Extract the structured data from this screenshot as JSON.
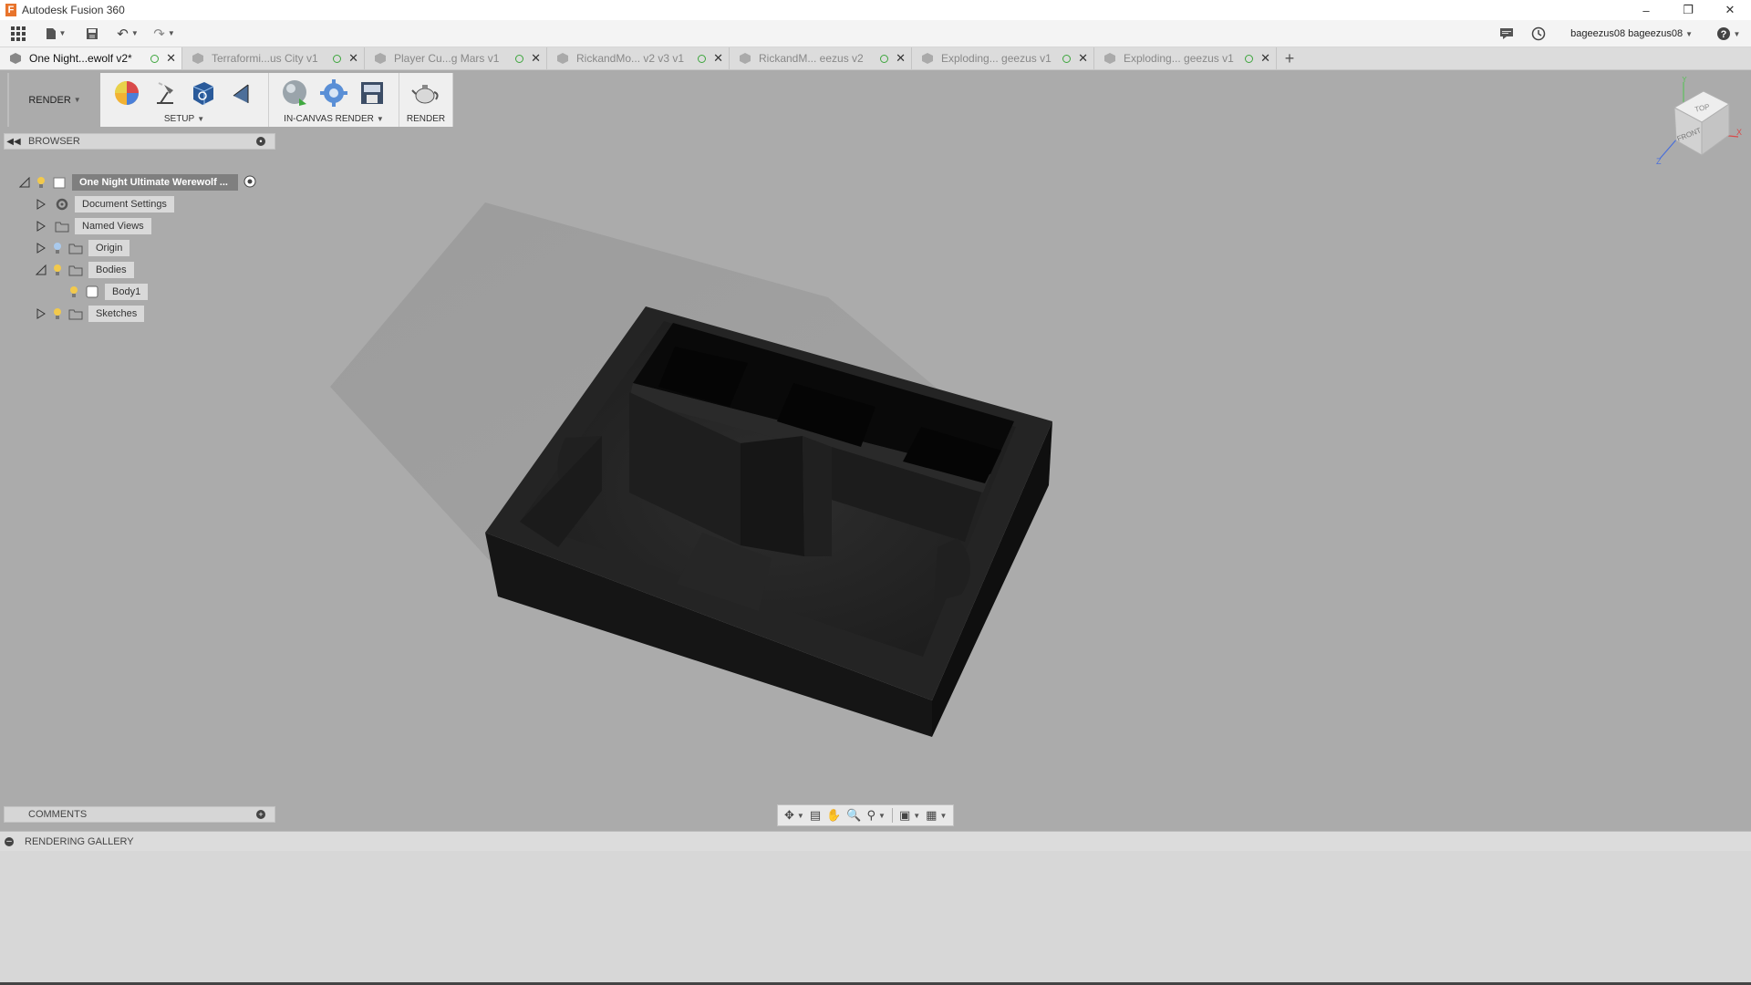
{
  "window": {
    "title": "Autodesk Fusion 360"
  },
  "appbar": {
    "user": "bageezus08 bageezus08"
  },
  "tabs": [
    {
      "label": "One Night...ewolf v2*",
      "active": true
    },
    {
      "label": "Terraformi...us City v1",
      "active": false
    },
    {
      "label": "Player Cu...g Mars v1",
      "active": false
    },
    {
      "label": "RickandMo... v2 v3 v1",
      "active": false
    },
    {
      "label": "RickandM... eezus v2",
      "active": false
    },
    {
      "label": "Exploding... geezus v1",
      "active": false
    },
    {
      "label": "Exploding... geezus v1",
      "active": false
    }
  ],
  "toolbar": {
    "workspace": "RENDER",
    "groups": [
      {
        "label": "SETUP"
      },
      {
        "label": "IN-CANVAS RENDER"
      },
      {
        "label": "RENDER"
      }
    ]
  },
  "browser": {
    "title": "BROWSER",
    "root": "One Night Ultimate Werewolf ...",
    "items": [
      {
        "label": "Document Settings"
      },
      {
        "label": "Named Views"
      },
      {
        "label": "Origin"
      },
      {
        "label": "Bodies"
      },
      {
        "label": "Body1"
      },
      {
        "label": "Sketches"
      }
    ]
  },
  "viewcube": {
    "top": "TOP",
    "front": "FRONT",
    "axis_x": "X",
    "axis_y": "Y",
    "axis_z": "Z"
  },
  "comments": {
    "title": "COMMENTS"
  },
  "gallery": {
    "title": "RENDERING GALLERY"
  },
  "colors": {
    "viewport_bg": "#ababab",
    "model": "#1a1a1a",
    "active_tab": "#f2f2f2",
    "tree_root": "#7f7f7f"
  }
}
